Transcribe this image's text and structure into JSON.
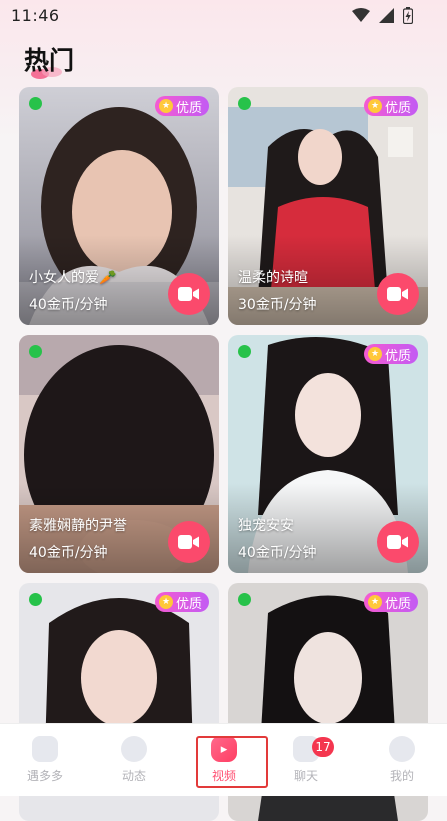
{
  "status_bar": {
    "time": "11:46",
    "icons": [
      "wifi-icon",
      "signal-icon",
      "battery-icon"
    ]
  },
  "header": {
    "title": "热门"
  },
  "cards": [
    {
      "name": "小女人的爱🥕",
      "price": "40金币/分钟",
      "online": true,
      "badge": "优质"
    },
    {
      "name": "温柔的诗暄",
      "price": "30金币/分钟",
      "online": true,
      "badge": "优质"
    },
    {
      "name": "素雅娴静的尹誉",
      "price": "40金币/分钟",
      "online": true,
      "badge": ""
    },
    {
      "name": "独宠安安",
      "price": "40金币/分钟",
      "online": true,
      "badge": "优质"
    },
    {
      "name": "",
      "price": "",
      "online": true,
      "badge": "优质"
    },
    {
      "name": "",
      "price": "",
      "online": true,
      "badge": "优质"
    }
  ],
  "bottom_nav": {
    "items": [
      {
        "label": "遇多多",
        "icon": "home-icon"
      },
      {
        "label": "动态",
        "icon": "moments-icon"
      },
      {
        "label": "视频",
        "icon": "video-icon",
        "active": true
      },
      {
        "label": "聊天",
        "icon": "chat-icon",
        "badge": "17"
      },
      {
        "label": "我的",
        "icon": "profile-icon"
      }
    ]
  },
  "colors": {
    "accent": "#fb4a6c",
    "online": "#27c24a",
    "badge_gradient_start": "#f45bd2",
    "badge_gradient_end": "#c35bf3",
    "unread": "#f4364f"
  }
}
